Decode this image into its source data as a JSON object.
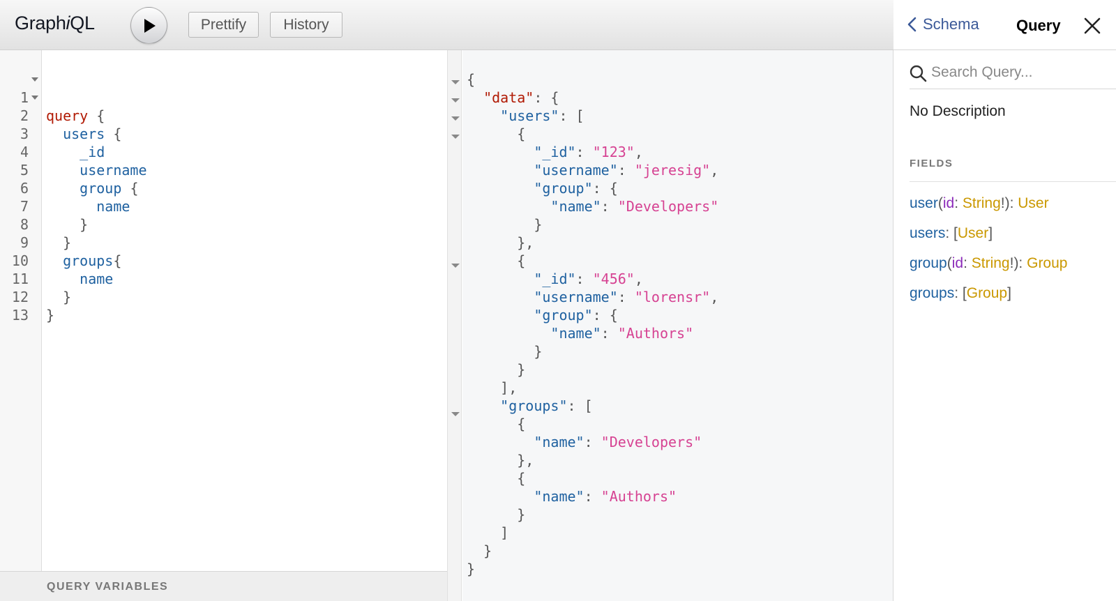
{
  "app": {
    "logo_prefix": "Graph",
    "logo_italic": "i",
    "logo_suffix": "QL"
  },
  "toolbar": {
    "prettify_label": "Prettify",
    "history_label": "History"
  },
  "editor": {
    "lines": [
      {
        "n": "1",
        "fold": true
      },
      {
        "n": "2",
        "fold": true
      },
      {
        "n": "3",
        "fold": false
      },
      {
        "n": "4",
        "fold": false
      },
      {
        "n": "5",
        "fold": false
      },
      {
        "n": "6",
        "fold": false
      },
      {
        "n": "7",
        "fold": false
      },
      {
        "n": "8",
        "fold": false
      },
      {
        "n": "9",
        "fold": false
      },
      {
        "n": "10",
        "fold": false
      },
      {
        "n": "11",
        "fold": false
      },
      {
        "n": "12",
        "fold": false
      },
      {
        "n": "13",
        "fold": false
      }
    ],
    "tokens": {
      "query": "query",
      "users": "users",
      "id": "_id",
      "username": "username",
      "group": "group",
      "name": "name",
      "groups": "groups",
      "name2": "name",
      "open": "{",
      "close": "}",
      "groups_open": "{"
    },
    "query_variables_label": "QUERY VARIABLES"
  },
  "result": {
    "k_data": "\"data\"",
    "k_users": "\"users\"",
    "k_id": "\"_id\"",
    "k_username": "\"username\"",
    "k_group": "\"group\"",
    "k_name": "\"name\"",
    "k_groups": "\"groups\"",
    "user1": {
      "id": "\"123\"",
      "username": "\"jeresig\"",
      "group_name": "\"Developers\""
    },
    "user2": {
      "id": "\"456\"",
      "username": "\"lorensr\"",
      "group_name": "\"Authors\""
    },
    "group1_name": "\"Developers\"",
    "group2_name": "\"Authors\""
  },
  "docs": {
    "back_label": "Schema",
    "title": "Query",
    "search_placeholder": "Search Query...",
    "description": "No Description",
    "fields_label": "FIELDS",
    "fields": {
      "user": {
        "name": "user",
        "arg": "id",
        "arg_type": "String",
        "type": "User"
      },
      "users": {
        "name": "users",
        "type": "User"
      },
      "group": {
        "name": "group",
        "arg": "id",
        "arg_type": "String",
        "type": "Group"
      },
      "groups": {
        "name": "groups",
        "type": "Group"
      }
    }
  },
  "colors": {
    "keyword": "#b11a04",
    "field": "#1f61a0",
    "string": "#d64292",
    "type": "#ca9800",
    "arg": "#8b2bb9",
    "link": "#3b5998"
  },
  "icons": [
    "play-icon",
    "chevron-left-icon",
    "close-icon",
    "search-icon"
  ]
}
